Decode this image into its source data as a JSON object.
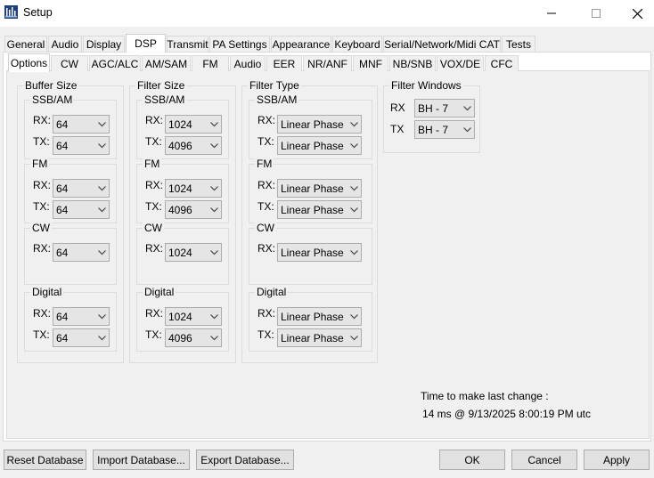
{
  "window": {
    "title": "Setup"
  },
  "main_tabs": [
    "General",
    "Audio",
    "Display",
    "DSP",
    "Transmit",
    "PA Settings",
    "Appearance",
    "Keyboard",
    "Serial/Network/Midi CAT",
    "Tests"
  ],
  "main_active": "DSP",
  "sub_tabs": [
    "Options",
    "CW",
    "AGC/ALC",
    "AM/SAM",
    "FM",
    "Audio",
    "EER",
    "NR/ANF",
    "MNF",
    "NB/SNB",
    "VOX/DE",
    "CFC"
  ],
  "sub_active": "Options",
  "groups": {
    "buffer_size": "Buffer Size",
    "filter_size": "Filter Size",
    "filter_type": "Filter Type",
    "filter_windows": "Filter Windows"
  },
  "modes": {
    "ssbam": "SSB/AM",
    "fm": "FM",
    "cw": "CW",
    "digital": "Digital"
  },
  "labels": {
    "rx": "RX:",
    "tx": "TX:",
    "rx_plain": "RX",
    "tx_plain": "TX"
  },
  "buffer": {
    "ssbam_rx": "64",
    "ssbam_tx": "64",
    "fm_rx": "64",
    "fm_tx": "64",
    "cw_rx": "64",
    "digital_rx": "64",
    "digital_tx": "64"
  },
  "filter_size": {
    "ssbam_rx": "1024",
    "ssbam_tx": "4096",
    "fm_rx": "1024",
    "fm_tx": "4096",
    "cw_rx": "1024",
    "digital_rx": "1024",
    "digital_tx": "4096"
  },
  "filter_type": {
    "ssbam_rx": "Linear Phase",
    "ssbam_tx": "Linear Phase",
    "fm_rx": "Linear Phase",
    "fm_tx": "Linear Phase",
    "cw_rx": "Linear Phase",
    "digital_rx": "Linear Phase",
    "digital_tx": "Linear Phase"
  },
  "filter_windows": {
    "rx": "BH - 7",
    "tx": "BH - 7"
  },
  "status": {
    "label": "Time to make last change :",
    "value": "14 ms @ 9/13/2025 8:00:19 PM utc"
  },
  "buttons": {
    "reset_db": "Reset Database",
    "import_db": "Import Database...",
    "export_db": "Export Database...",
    "ok": "OK",
    "cancel": "Cancel",
    "apply": "Apply"
  }
}
